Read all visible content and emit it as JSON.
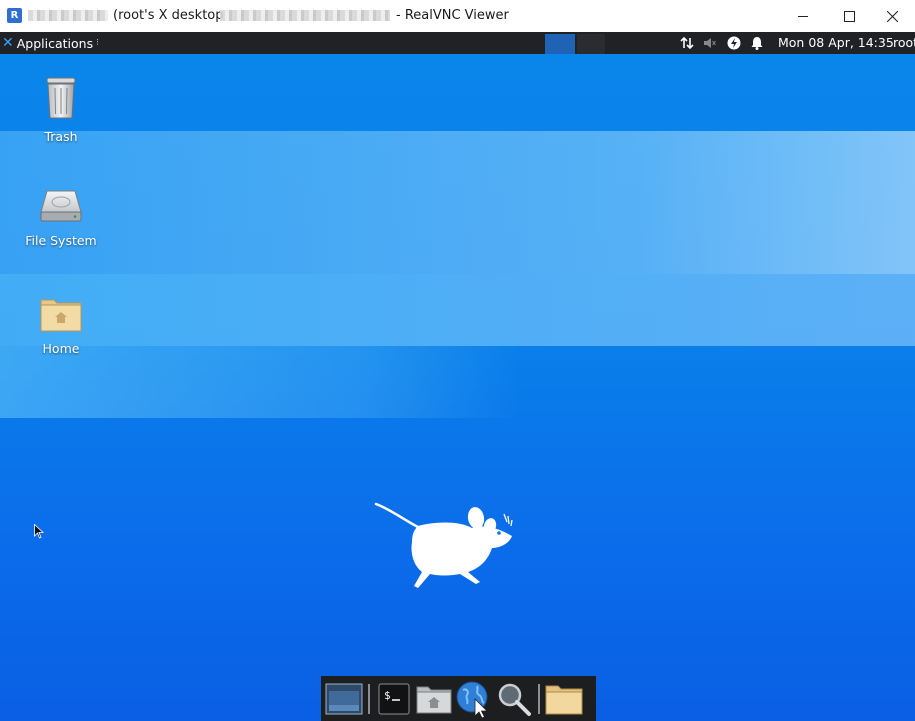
{
  "window": {
    "title_prefix": "(root's X desktop",
    "title_suffix": "- RealVNC Viewer",
    "controls": [
      "minimize",
      "maximize",
      "close"
    ]
  },
  "panel": {
    "apps_label": "Applications",
    "clock": "Mon 08 Apr, 14:35",
    "user": "root"
  },
  "desktop_icons": [
    {
      "label": "Trash",
      "icon": "trash-icon"
    },
    {
      "label": "File System",
      "icon": "drive-icon"
    },
    {
      "label": "Home",
      "icon": "home-folder-icon"
    }
  ],
  "dock": {
    "items": [
      "show-desktop",
      "terminal",
      "home-folder",
      "web-browser",
      "search",
      "file-manager"
    ]
  },
  "colors": {
    "panel": "#202225",
    "desktop_top": "#0a86ea",
    "desktop_bottom": "#0a5fe3",
    "accent": "#3aa0ff"
  }
}
